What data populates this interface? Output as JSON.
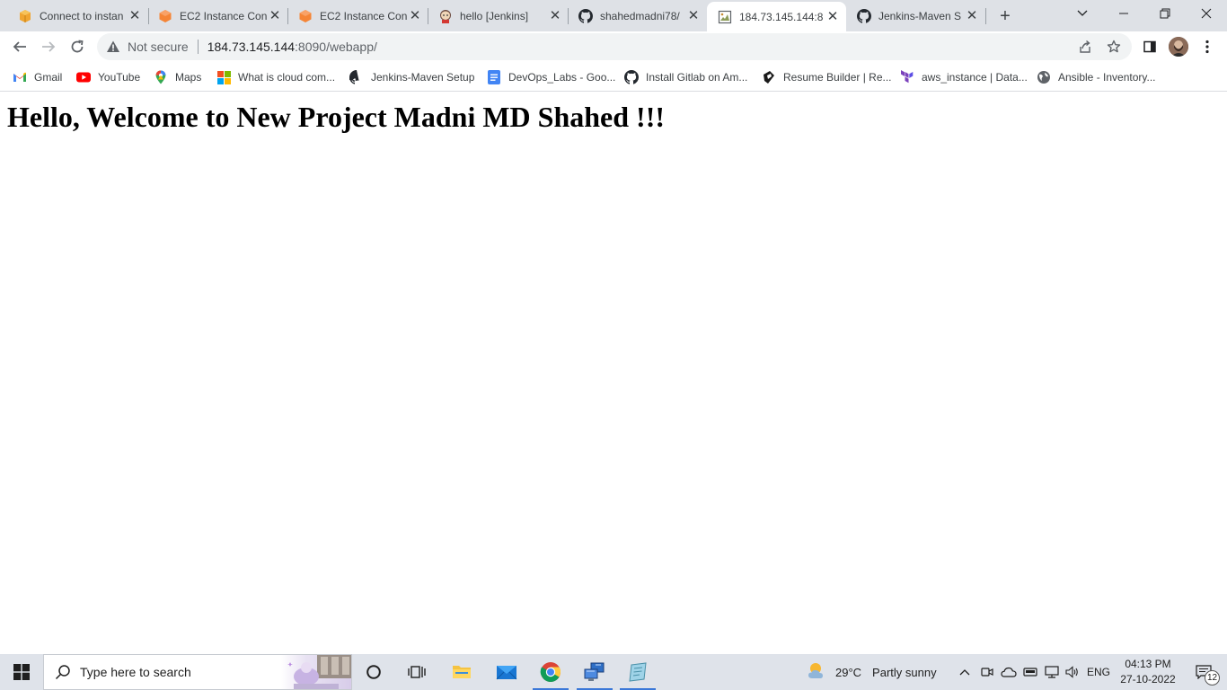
{
  "browser": {
    "tabs": [
      {
        "title": "Connect to instan",
        "favicon": "aws-cube-icon",
        "active": false
      },
      {
        "title": "EC2 Instance Con",
        "favicon": "aws-ec2-icon",
        "active": false
      },
      {
        "title": "EC2 Instance Con",
        "favicon": "aws-ec2-icon",
        "active": false
      },
      {
        "title": "hello [Jenkins]",
        "favicon": "jenkins-icon",
        "active": false
      },
      {
        "title": "shahedmadni78/",
        "favicon": "github-icon",
        "active": false
      },
      {
        "title": "184.73.145.144:8",
        "favicon": "broken-image-icon",
        "active": true
      },
      {
        "title": "Jenkins-Maven S",
        "favicon": "github-icon",
        "active": false
      }
    ],
    "close_glyph": "✕",
    "new_tab_glyph": "+",
    "security_label": "Not secure",
    "url_host": "184.73.145.144",
    "url_rest": ":8090/webapp/"
  },
  "bookmarks": [
    {
      "label": "Gmail",
      "icon": "gmail-icon"
    },
    {
      "label": "YouTube",
      "icon": "youtube-icon"
    },
    {
      "label": "Maps",
      "icon": "maps-icon"
    },
    {
      "label": "What is cloud com...",
      "icon": "microsoft-icon"
    },
    {
      "label": "Jenkins-Maven Setup",
      "icon": "github-icon"
    },
    {
      "label": "DevOps_Labs - Goo...",
      "icon": "google-docs-icon"
    },
    {
      "label": "Install Gitlab on Am...",
      "icon": "github-icon"
    },
    {
      "label": "Resume Builder | Re...",
      "icon": "resume-icon"
    },
    {
      "label": "aws_instance | Data...",
      "icon": "terraform-icon"
    },
    {
      "label": "Ansible - Inventory...",
      "icon": "globe-icon"
    }
  ],
  "page": {
    "heading": "Hello, Welcome to New Project Madni MD Shahed !!!"
  },
  "taskbar": {
    "search_placeholder": "Type here to search",
    "weather_temp": "29°C",
    "weather_condition": "Partly sunny",
    "language": "ENG",
    "time": "04:13 PM",
    "date": "27-10-2022",
    "notification_count": "12"
  },
  "colors": {
    "tabstrip": "#dee1e6",
    "taskbar": "#dfe3ea",
    "aws_orange": "#f58536",
    "chrome_red": "#db4437",
    "running_indicator": "#3b78d8"
  }
}
